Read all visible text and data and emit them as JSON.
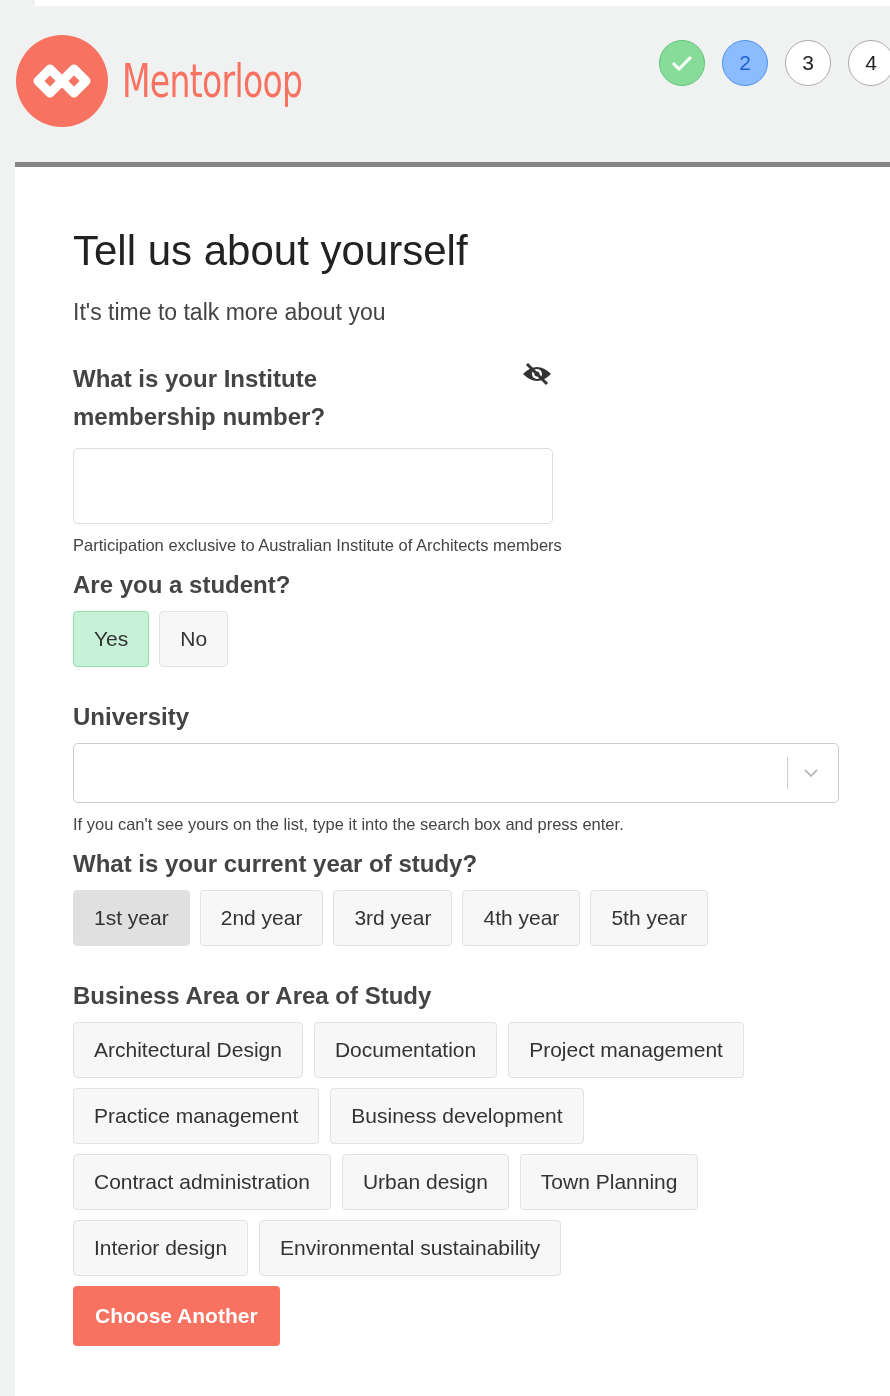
{
  "brand": "Mentorloop",
  "steps": [
    {
      "kind": "done"
    },
    {
      "kind": "current",
      "label": "2"
    },
    {
      "kind": "pending",
      "label": "3"
    },
    {
      "kind": "pending",
      "label": "4"
    }
  ],
  "title": "Tell us about yourself",
  "subtitle": "It's time to talk more about you",
  "membership": {
    "label": "What is your Institute membership number?",
    "hidden": true,
    "help": "Participation exclusive to Australian Institute of Architects members"
  },
  "student": {
    "label": "Are you a student?",
    "options": [
      {
        "label": "Yes",
        "selected": true
      },
      {
        "label": "No",
        "selected": false
      }
    ]
  },
  "university": {
    "label": "University",
    "help": "If you can't see yours on the list, type it into the search box and press enter."
  },
  "year": {
    "label": "What is your current year of study?",
    "options": [
      {
        "label": "1st year",
        "selected": true
      },
      {
        "label": "2nd year",
        "selected": false
      },
      {
        "label": "3rd year",
        "selected": false
      },
      {
        "label": "4th year",
        "selected": false
      },
      {
        "label": "5th year",
        "selected": false
      }
    ]
  },
  "area": {
    "label": "Business Area or Area of Study",
    "options": [
      {
        "label": "Architectural Design",
        "selected": false
      },
      {
        "label": "Documentation",
        "selected": false
      },
      {
        "label": "Project management",
        "selected": false
      },
      {
        "label": "Practice management",
        "selected": false
      },
      {
        "label": "Business development",
        "selected": false
      },
      {
        "label": "Contract administration",
        "selected": false
      },
      {
        "label": "Urban design",
        "selected": false
      },
      {
        "label": "Town Planning",
        "selected": false
      },
      {
        "label": "Interior design",
        "selected": false
      },
      {
        "label": "Environmental sustainability",
        "selected": false
      }
    ]
  },
  "action": "Choose Another"
}
